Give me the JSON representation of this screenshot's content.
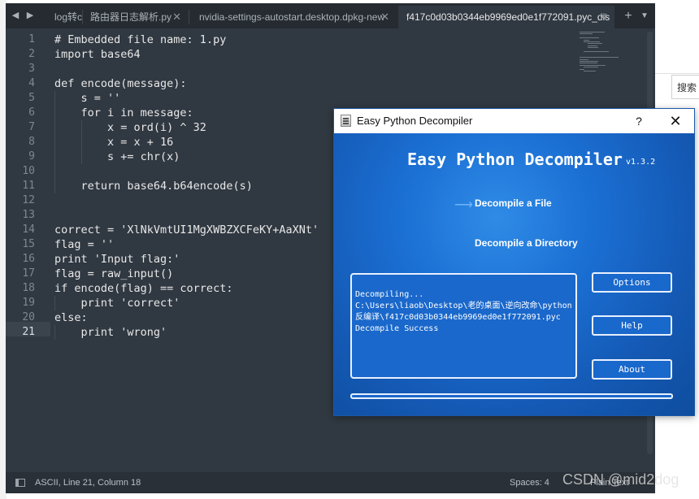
{
  "background": {
    "search_label": "搜索"
  },
  "editor": {
    "tabs": [
      {
        "label": "log转c"
      },
      {
        "label": "路由器日志解析.py"
      },
      {
        "label": "nvidia-settings-autostart.desktop.dpkg-new"
      },
      {
        "label": "f417c0d03b0344eb9969ed0e1f772091.pyc_dis"
      }
    ],
    "line_numbers": [
      "1",
      "2",
      "3",
      "4",
      "5",
      "6",
      "7",
      "8",
      "9",
      "10",
      "11",
      "12",
      "13",
      "14",
      "15",
      "16",
      "17",
      "18",
      "19",
      "20",
      "21"
    ],
    "current_line": 21,
    "code_lines": [
      "# Embedded file name: 1.py",
      "import base64",
      "",
      "def encode(message):",
      "    s = ''",
      "    for i in message:",
      "        x = ord(i) ^ 32",
      "        x = x + 16",
      "        s += chr(x)",
      "",
      "    return base64.b64encode(s)",
      "",
      "",
      "correct = 'XlNkVmtUI1MgXWBZXCFeKY+AaXNt'",
      "flag = ''",
      "print 'Input flag:'",
      "flag = raw_input()",
      "if encode(flag) == correct:",
      "    print 'correct'",
      "else:",
      "    print 'wrong'"
    ],
    "status": {
      "position": "ASCII, Line 21, Column 18",
      "spaces": "Spaces: 4",
      "syntax": "Plain Text"
    },
    "watermark": "CSDN @mid2dog"
  },
  "dialog": {
    "title": "Easy Python Decompiler",
    "help_glyph": "?",
    "close_glyph": "✕",
    "heading": "Easy Python Decompiler",
    "version": "v1.3.2",
    "decompile_file": "Decompile a File",
    "decompile_dir": "Decompile a Directory",
    "log": [
      "Decompiling...",
      "C:\\Users\\liaob\\Desktop\\老的桌面\\逆向改命\\python反编译\\f417c0d03b0344eb9969ed0e1f772091.pyc",
      "Decompile Success"
    ],
    "buttons": {
      "options": "Options",
      "help": "Help",
      "about": "About"
    }
  },
  "icons": {
    "back": "chevron-left-icon",
    "forward": "chevron-right-icon",
    "new_tab": "plus-icon",
    "tab_menu": "chevron-down-icon"
  }
}
